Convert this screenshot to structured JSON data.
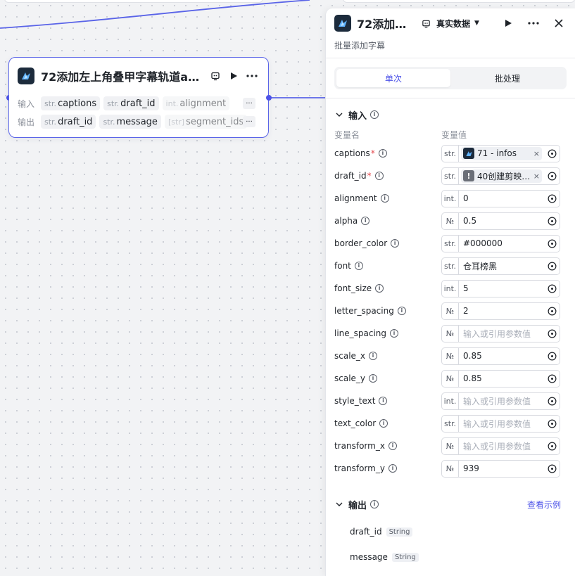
{
  "node": {
    "title": "72添加左上角叠甲字幕轨道a…",
    "input_label": "输入",
    "output_label": "输出",
    "inputs": [
      {
        "type": "str.",
        "name": "captions"
      },
      {
        "type": "str.",
        "name": "draft_id"
      },
      {
        "type": "int.",
        "name": "alignment"
      }
    ],
    "outputs": [
      {
        "type": "str.",
        "name": "draft_id"
      },
      {
        "type": "str.",
        "name": "message"
      },
      {
        "type": "[str]",
        "name": "segment_ids"
      }
    ],
    "more": "···"
  },
  "panel": {
    "title": "72添加…",
    "data_mode": "真实数据",
    "subtitle": "批量添加字幕",
    "tabs": [
      "单次",
      "批处理"
    ],
    "input_section": "输入",
    "col_name": "变量名",
    "col_value": "变量值",
    "params": [
      {
        "name": "captions",
        "required": true,
        "type": "str.",
        "kind": "ref",
        "value": "71 - infos"
      },
      {
        "name": "draft_id",
        "required": true,
        "type": "str.",
        "kind": "ref-warn",
        "value": "40创建剪映…"
      },
      {
        "name": "alignment",
        "type": "int.",
        "value": "0"
      },
      {
        "name": "alpha",
        "type": "№",
        "value": "0.5"
      },
      {
        "name": "border_color",
        "type": "str.",
        "value": "#000000"
      },
      {
        "name": "font",
        "type": "str.",
        "value": "仓耳榜黑"
      },
      {
        "name": "font_size",
        "type": "int.",
        "value": "5"
      },
      {
        "name": "letter_spacing",
        "type": "№",
        "value": "2"
      },
      {
        "name": "line_spacing",
        "type": "№",
        "placeholder": "输入或引用参数值"
      },
      {
        "name": "scale_x",
        "type": "№",
        "value": "0.85"
      },
      {
        "name": "scale_y",
        "type": "№",
        "value": "0.85"
      },
      {
        "name": "style_text",
        "type": "int.",
        "placeholder": "输入或引用参数值"
      },
      {
        "name": "text_color",
        "type": "str.",
        "placeholder": "输入或引用参数值"
      },
      {
        "name": "transform_x",
        "type": "№",
        "placeholder": "输入或引用参数值"
      },
      {
        "name": "transform_y",
        "type": "№",
        "value": "939"
      }
    ],
    "output_section": "输出",
    "view_example": "查看示例",
    "outputs": [
      {
        "name": "draft_id",
        "type": "String"
      },
      {
        "name": "message",
        "type": "String"
      }
    ]
  },
  "colors": {
    "accent": "#4d53e8",
    "required": "#e5484d"
  }
}
